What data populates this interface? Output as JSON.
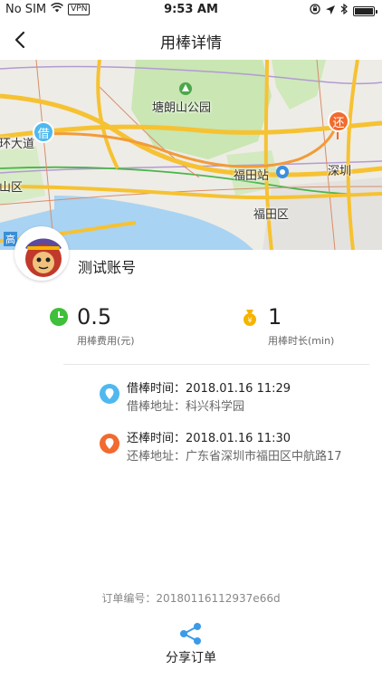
{
  "status_bar": {
    "carrier": "No SIM",
    "vpn": "VPN",
    "time": "9:53 AM"
  },
  "nav": {
    "title": "用棒详情"
  },
  "map": {
    "labels": {
      "park": "塘朗山公园",
      "station": "福田站",
      "district": "福田区",
      "city": "深圳",
      "road": "北环大道",
      "left_area": "南山区",
      "bottom_left": "高"
    },
    "borrow_marker": "借",
    "return_marker": "还"
  },
  "account": {
    "name": "测试账号"
  },
  "stats": {
    "fee_value": "0.5",
    "fee_label": "用棒费用(元)",
    "duration_value": "1",
    "duration_label": "用棒时长(min)"
  },
  "borrow": {
    "time_key": "借棒时间：",
    "time_value": "2018.01.16 11:29",
    "addr_key": "借棒地址：",
    "addr_value": "科兴科学园"
  },
  "return": {
    "time_key": "还棒时间：",
    "time_value": "2018.01.16 11:30",
    "addr_key": "还棒地址：",
    "addr_value": "广东省深圳市福田区中航路17"
  },
  "order": {
    "key": "订单编号：",
    "value": "20180116112937e66d"
  },
  "share": {
    "label": "分享订单"
  },
  "colors": {
    "green": "#3fbf3a",
    "gold": "#f5b400",
    "borrow_blue": "#4fb8f0",
    "return_orange": "#f26a2e",
    "share_blue": "#3c9be8"
  }
}
